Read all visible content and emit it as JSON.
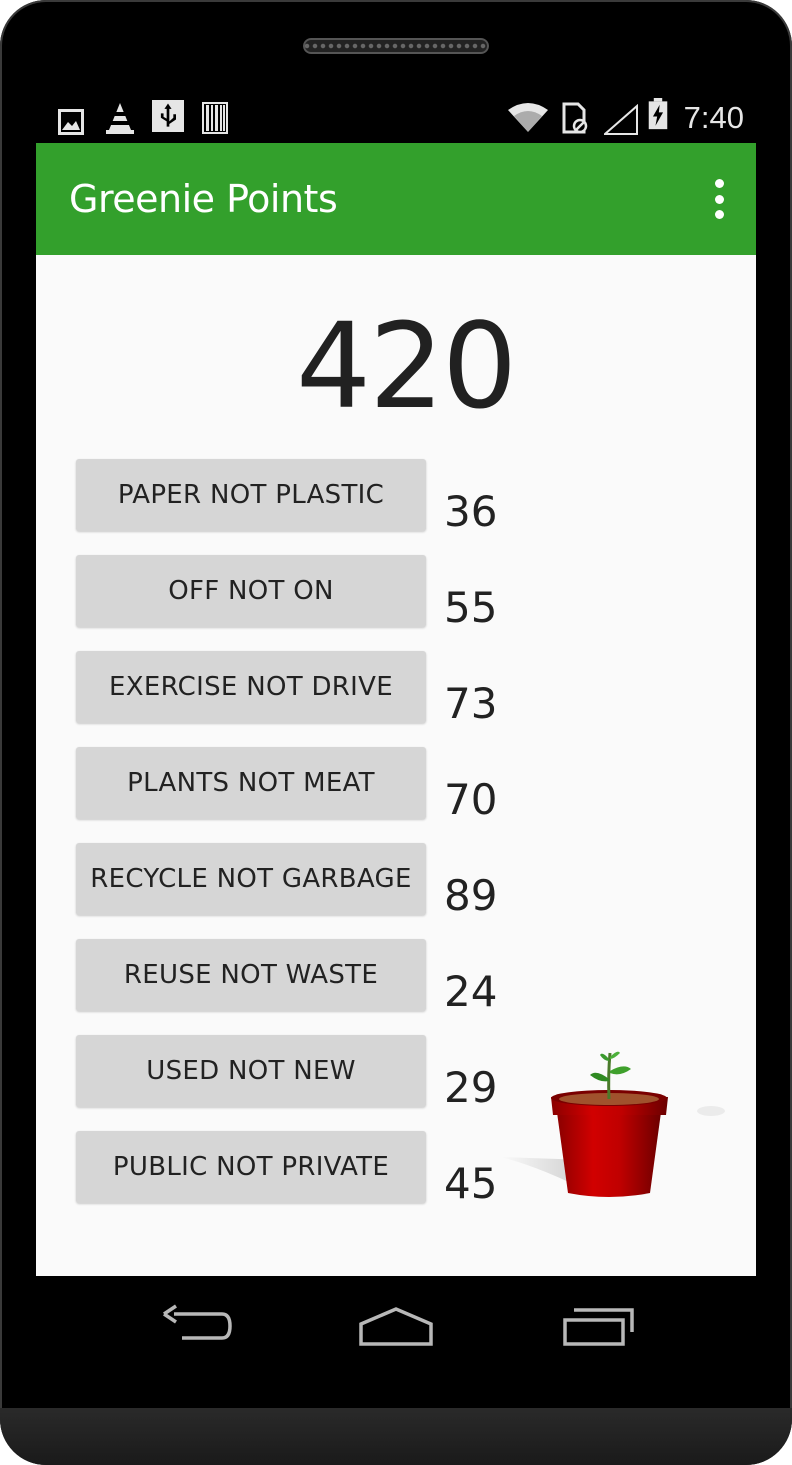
{
  "status_bar": {
    "left_icons": [
      "image-icon",
      "vlc-cone-icon",
      "usb-icon",
      "barcode-icon"
    ],
    "right_icons": [
      "wifi-icon",
      "sim-icon",
      "signal-icon",
      "battery-charging-icon"
    ],
    "time": "7:40"
  },
  "app_bar": {
    "title": "Greenie Points",
    "menu_icon": "overflow-menu-icon",
    "color": "#33a02c"
  },
  "main": {
    "total_points": "420",
    "actions": [
      {
        "label": "PAPER NOT PLASTIC",
        "points": "36"
      },
      {
        "label": "OFF NOT ON",
        "points": "55"
      },
      {
        "label": "EXERCISE NOT DRIVE",
        "points": "73"
      },
      {
        "label": "PLANTS NOT MEAT",
        "points": "70"
      },
      {
        "label": "RECYCLE NOT GARBAGE",
        "points": "89"
      },
      {
        "label": "REUSE NOT WASTE",
        "points": "24"
      },
      {
        "label": "USED NOT NEW",
        "points": "29"
      },
      {
        "label": "PUBLIC NOT PRIVATE",
        "points": "45"
      }
    ],
    "illustration": "potted-seedling-image"
  },
  "nav_bar": {
    "buttons": [
      "back-icon",
      "home-icon",
      "recent-apps-icon"
    ]
  }
}
